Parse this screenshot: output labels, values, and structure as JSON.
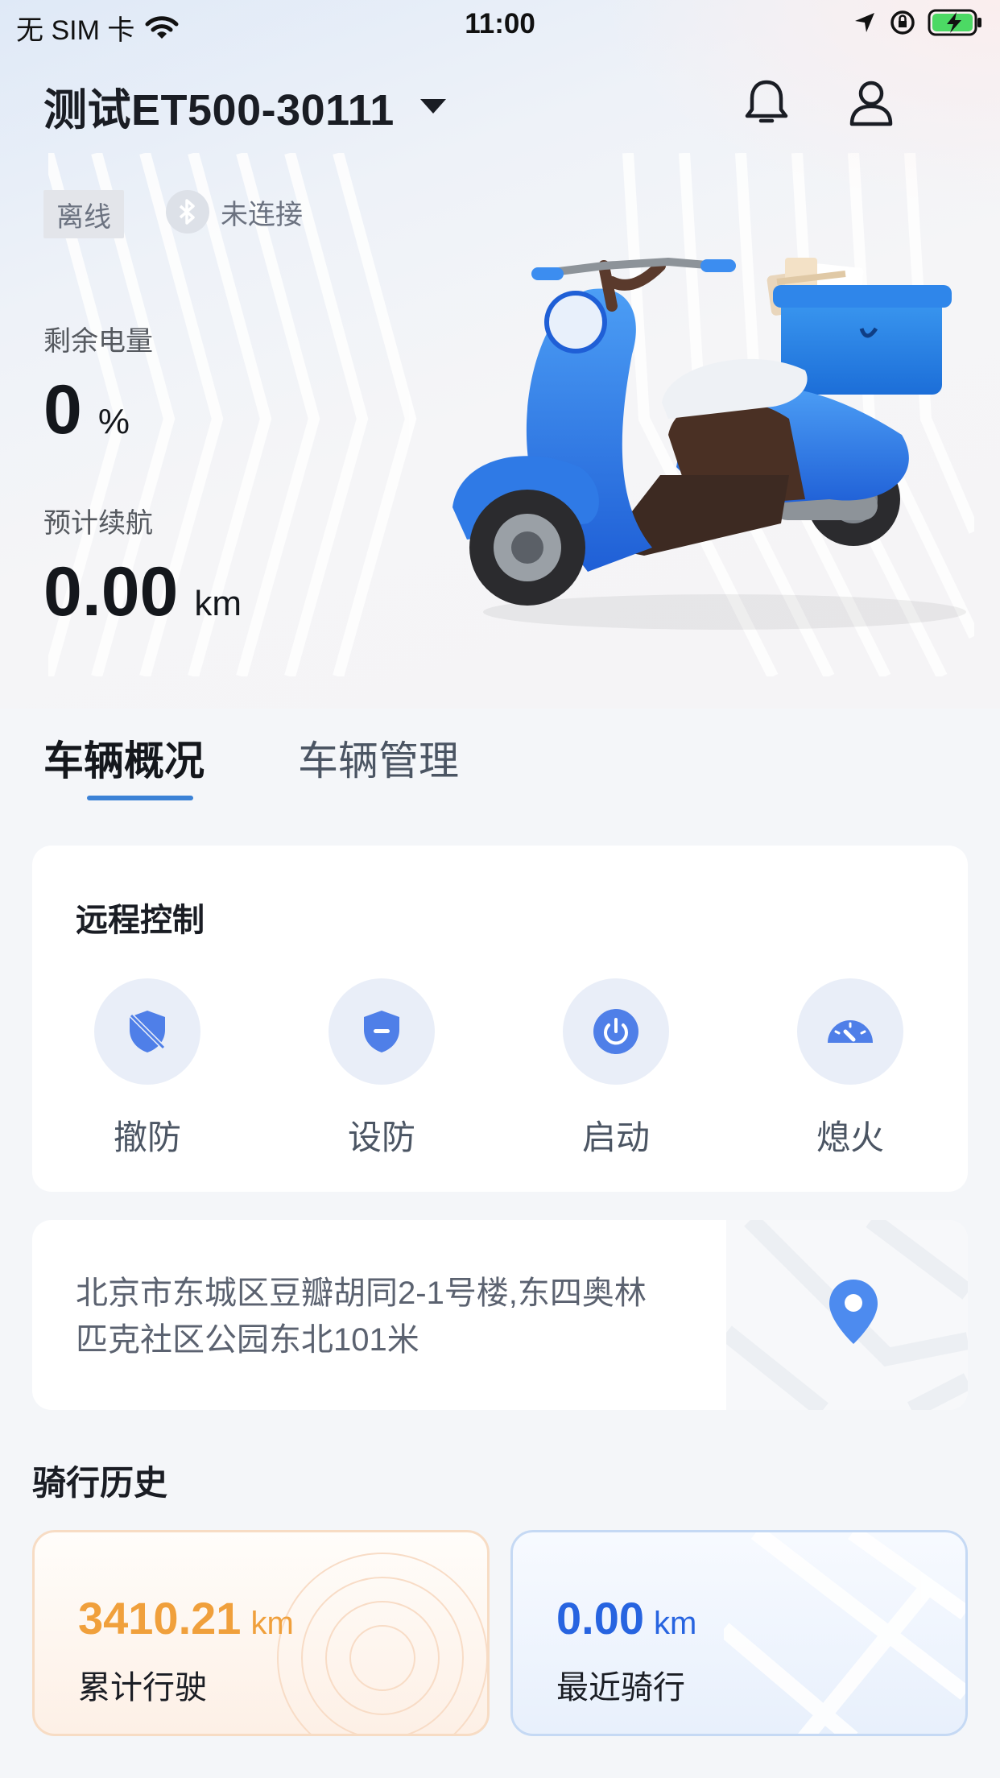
{
  "status_bar": {
    "carrier": "无 SIM 卡",
    "time": "11:00"
  },
  "header": {
    "vehicle_name": "测试ET500-30111"
  },
  "status": {
    "online": "离线",
    "bluetooth": "未连接"
  },
  "battery": {
    "label": "剩余电量",
    "value": "0",
    "unit": "%"
  },
  "range": {
    "label": "预计续航",
    "value": "0.00",
    "unit": "km"
  },
  "tabs": [
    {
      "label": "车辆概况",
      "active": true
    },
    {
      "label": "车辆管理",
      "active": false
    }
  ],
  "remote_control": {
    "title": "远程控制",
    "actions": [
      {
        "label": "撤防",
        "icon": "shield-off-icon"
      },
      {
        "label": "设防",
        "icon": "shield-icon"
      },
      {
        "label": "启动",
        "icon": "power-icon"
      },
      {
        "label": "熄火",
        "icon": "speedometer-icon"
      }
    ]
  },
  "location": {
    "address_line1": "北京市东城区豆瓣胡同2-1号楼,东四奥林",
    "address_line2": "匹克社区公园东北101米"
  },
  "ride_history": {
    "title": "骑行历史",
    "total": {
      "value": "3410.21",
      "unit": "km",
      "label": "累计行驶"
    },
    "recent": {
      "value": "0.00",
      "unit": "km",
      "label": "最近骑行"
    }
  },
  "colors": {
    "accent": "#3b82d6",
    "total_orange": "#f0a03c",
    "recent_blue": "#2764e0"
  }
}
